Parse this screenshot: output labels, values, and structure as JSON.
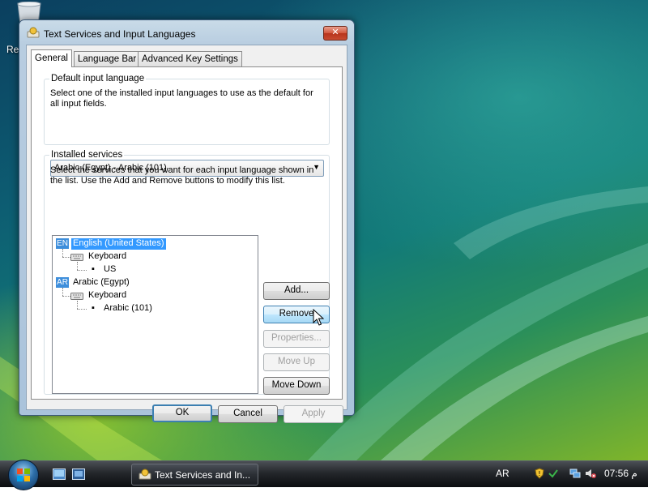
{
  "desktop": {
    "icon_label_fragment": "Re",
    "icons": [
      "recycle-bin-icon"
    ]
  },
  "window": {
    "title": "Text Services and Input Languages",
    "close_glyph": "✕",
    "tabs": [
      {
        "label": "General",
        "active": true
      },
      {
        "label": "Language Bar",
        "active": false
      },
      {
        "label": "Advanced Key Settings",
        "active": false
      }
    ],
    "default_language": {
      "group_title": "Default input language",
      "description": "Select one of the installed input languages to use as the default for all input fields.",
      "selected": "Arabic (Egypt) - Arabic (101)"
    },
    "installed_services": {
      "group_title": "Installed services",
      "description": "Select the services that you want for each input language shown in the list. Use the Add and Remove buttons to modify this list.",
      "tree": [
        {
          "badge": "EN",
          "language": "English (United States)",
          "selected": true,
          "category": "Keyboard",
          "layout": "US"
        },
        {
          "badge": "AR",
          "language": "Arabic (Egypt)",
          "selected": false,
          "category": "Keyboard",
          "layout": "Arabic (101)"
        }
      ],
      "buttons": {
        "add": "Add...",
        "remove": "Remove",
        "properties": "Properties...",
        "move_up": "Move Up",
        "move_down": "Move Down"
      }
    },
    "footer": {
      "ok": "OK",
      "cancel": "Cancel",
      "apply": "Apply"
    }
  },
  "taskbar": {
    "task_title": "Text Services and In...",
    "language_indicator": "AR",
    "clock": "07:56 م",
    "tray_icons": [
      "security-shield-icon",
      "network-icon",
      "volume-muted-icon"
    ]
  },
  "colors": {
    "selection": "#3399ff",
    "badge": "#3e8edb",
    "close_button": "#c84a30"
  }
}
